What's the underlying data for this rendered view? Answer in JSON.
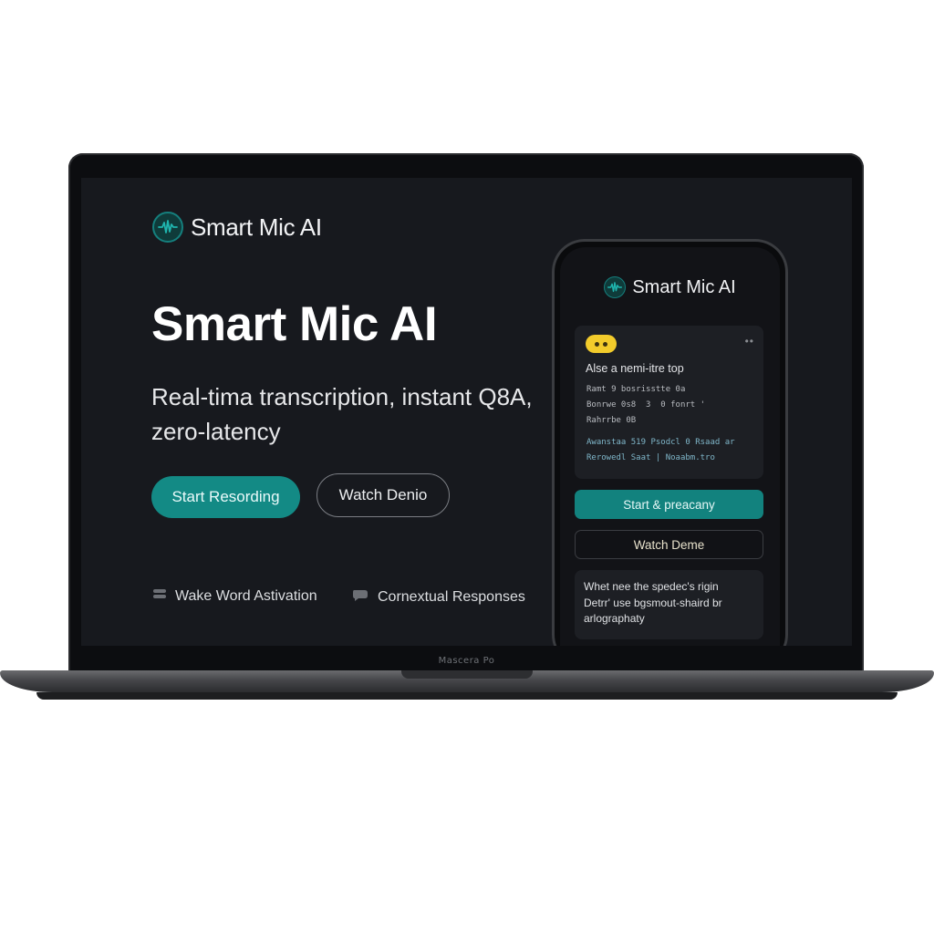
{
  "brand": {
    "name": "Smart Mic AI"
  },
  "hero": {
    "title": "Smart Mic AI",
    "subtitle": "Real-tima transcription, instant Q8A, zero-latency"
  },
  "buttons": {
    "primary": "Start Resording",
    "secondary": "Watch Denio"
  },
  "features": [
    {
      "label": "Wake Word Astivation",
      "icon": "toggle-icon"
    },
    {
      "label": "Cornextual Responses",
      "icon": "chat-icon"
    }
  ],
  "phone": {
    "brand_name": "Smart Mic AI",
    "card": {
      "title": "Alse a nemi-itre top",
      "lines": [
        "Ramt 9 bosrisstte 0a",
        "Bonrwe 0s8  3  0 fonrt '",
        "Rahrrbe 0B",
        "Awanstaa 519 Psodcl 0 Rsaad ar",
        "Rerowedl Saat | Noaabm.tro"
      ]
    },
    "primary_button": "Start & preacany",
    "secondary_button": "Watch Deme",
    "note_lines": [
      "Whet nee the spedec's rigin",
      "Detrr' use bgsmout-shaird br",
      "arlographaty"
    ]
  },
  "device_label": "Mascera Po",
  "colors": {
    "accent": "#138a85",
    "background": "#17191e",
    "highlight": "#f2cb2b"
  }
}
